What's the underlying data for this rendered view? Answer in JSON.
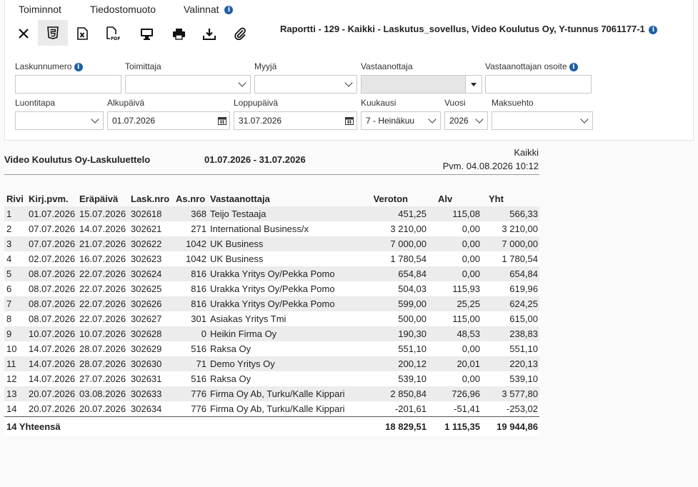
{
  "menu": {
    "toiminnot": "Toiminnot",
    "tiedostomuoto": "Tiedostomuoto",
    "valinnat": "Valinnat"
  },
  "toolbar": {
    "icons": [
      "close-icon",
      "html5-icon",
      "excel-icon",
      "pdf-icon",
      "monitor-icon",
      "print-icon",
      "download-icon",
      "attachment-icon"
    ]
  },
  "report_title": "Raportti - 129 - Kaikki - Laskutus_sovellus, Video Koulutus Oy, Y-tunnus 7061177-1",
  "filters": {
    "laskunnumero": {
      "label": "Laskunnumero",
      "value": ""
    },
    "toimittaja": {
      "label": "Toimittaja",
      "value": ""
    },
    "myyja": {
      "label": "Myyjä",
      "value": ""
    },
    "vastaanottaja": {
      "label": "Vastaanottaja",
      "value": ""
    },
    "vastaanottajan_osoite": {
      "label": "Vastaanottajan osoite",
      "value": ""
    },
    "luontitapa": {
      "label": "Luontitapa",
      "value": ""
    },
    "alkupaiva": {
      "label": "Alkupäivä",
      "value": "01.07.2026"
    },
    "loppupaiva": {
      "label": "Loppupäivä",
      "value": "31.07.2026"
    },
    "kuukausi": {
      "label": "Kuukausi",
      "value": "7 - Heinäkuu"
    },
    "vuosi": {
      "label": "Vuosi",
      "value": "2026"
    },
    "maksuehto": {
      "label": "Maksuehto",
      "value": ""
    }
  },
  "report": {
    "company_title": "Video Koulutus Oy-Laskuluettelo",
    "period": "01.07.2026 - 31.07.2026",
    "scope": "Kaikki",
    "printed": "Pvm. 04.08.2026 10:12",
    "columns": [
      "Rivi",
      "Kirj.pvm.",
      "Eräpäivä",
      "Lask.nro",
      "As.nro",
      "Vastaanottaja",
      "Veroton",
      "Alv",
      "Yht"
    ],
    "rows": [
      [
        "1",
        "01.07.2026",
        "15.07.2026",
        "302618",
        "368",
        "Teijo Testaaja",
        "451,25",
        "115,08",
        "566,33"
      ],
      [
        "2",
        "07.07.2026",
        "14.07.2026",
        "302621",
        "271",
        "International Business/x",
        "3 210,00",
        "0,00",
        "3 210,00"
      ],
      [
        "3",
        "07.07.2026",
        "21.07.2026",
        "302622",
        "1042",
        "UK Business",
        "7 000,00",
        "0,00",
        "7 000,00"
      ],
      [
        "4",
        "02.07.2026",
        "16.07.2026",
        "302623",
        "1042",
        "UK Business",
        "1 780,54",
        "0,00",
        "1 780,54"
      ],
      [
        "5",
        "08.07.2026",
        "22.07.2026",
        "302624",
        "816",
        "Urakka Yritys Oy/Pekka Pomo",
        "654,84",
        "0,00",
        "654,84"
      ],
      [
        "6",
        "08.07.2026",
        "22.07.2026",
        "302625",
        "816",
        "Urakka Yritys Oy/Pekka Pomo",
        "504,03",
        "115,93",
        "619,96"
      ],
      [
        "7",
        "08.07.2026",
        "22.07.2026",
        "302626",
        "816",
        "Urakka Yritys Oy/Pekka Pomo",
        "599,00",
        "25,25",
        "624,25"
      ],
      [
        "8",
        "08.07.2026",
        "22.07.2026",
        "302627",
        "301",
        "Asiakas Yritys Tmi",
        "500,00",
        "115,00",
        "615,00"
      ],
      [
        "9",
        "10.07.2026",
        "10.07.2026",
        "302628",
        "0",
        "Heikin Firma Oy",
        "190,30",
        "48,53",
        "238,83"
      ],
      [
        "10",
        "14.07.2026",
        "28.07.2026",
        "302629",
        "516",
        "Raksa Oy",
        "551,10",
        "0,00",
        "551,10"
      ],
      [
        "11",
        "14.07.2026",
        "28.07.2026",
        "302630",
        "71",
        "Demo Yritys Oy",
        "200,12",
        "20,01",
        "220,13"
      ],
      [
        "12",
        "14.07.2026",
        "27.07.2026",
        "302631",
        "516",
        "Raksa Oy",
        "539,10",
        "0,00",
        "539,10"
      ],
      [
        "13",
        "20.07.2026",
        "03.08.2026",
        "302633",
        "776",
        "Firma Oy Ab, Turku/Kalle Kippari",
        "2 850,84",
        "726,96",
        "3 577,80"
      ],
      [
        "14",
        "20.07.2026",
        "20.07.2026",
        "302634",
        "776",
        "Firma Oy Ab, Turku/Kalle Kippari",
        "-201,61",
        "-51,41",
        "-253,02"
      ]
    ],
    "totals": {
      "label": "14 Yhteensä",
      "veroton": "18 829,51",
      "alv": "1 115,35",
      "yht": "19 944,86"
    }
  }
}
